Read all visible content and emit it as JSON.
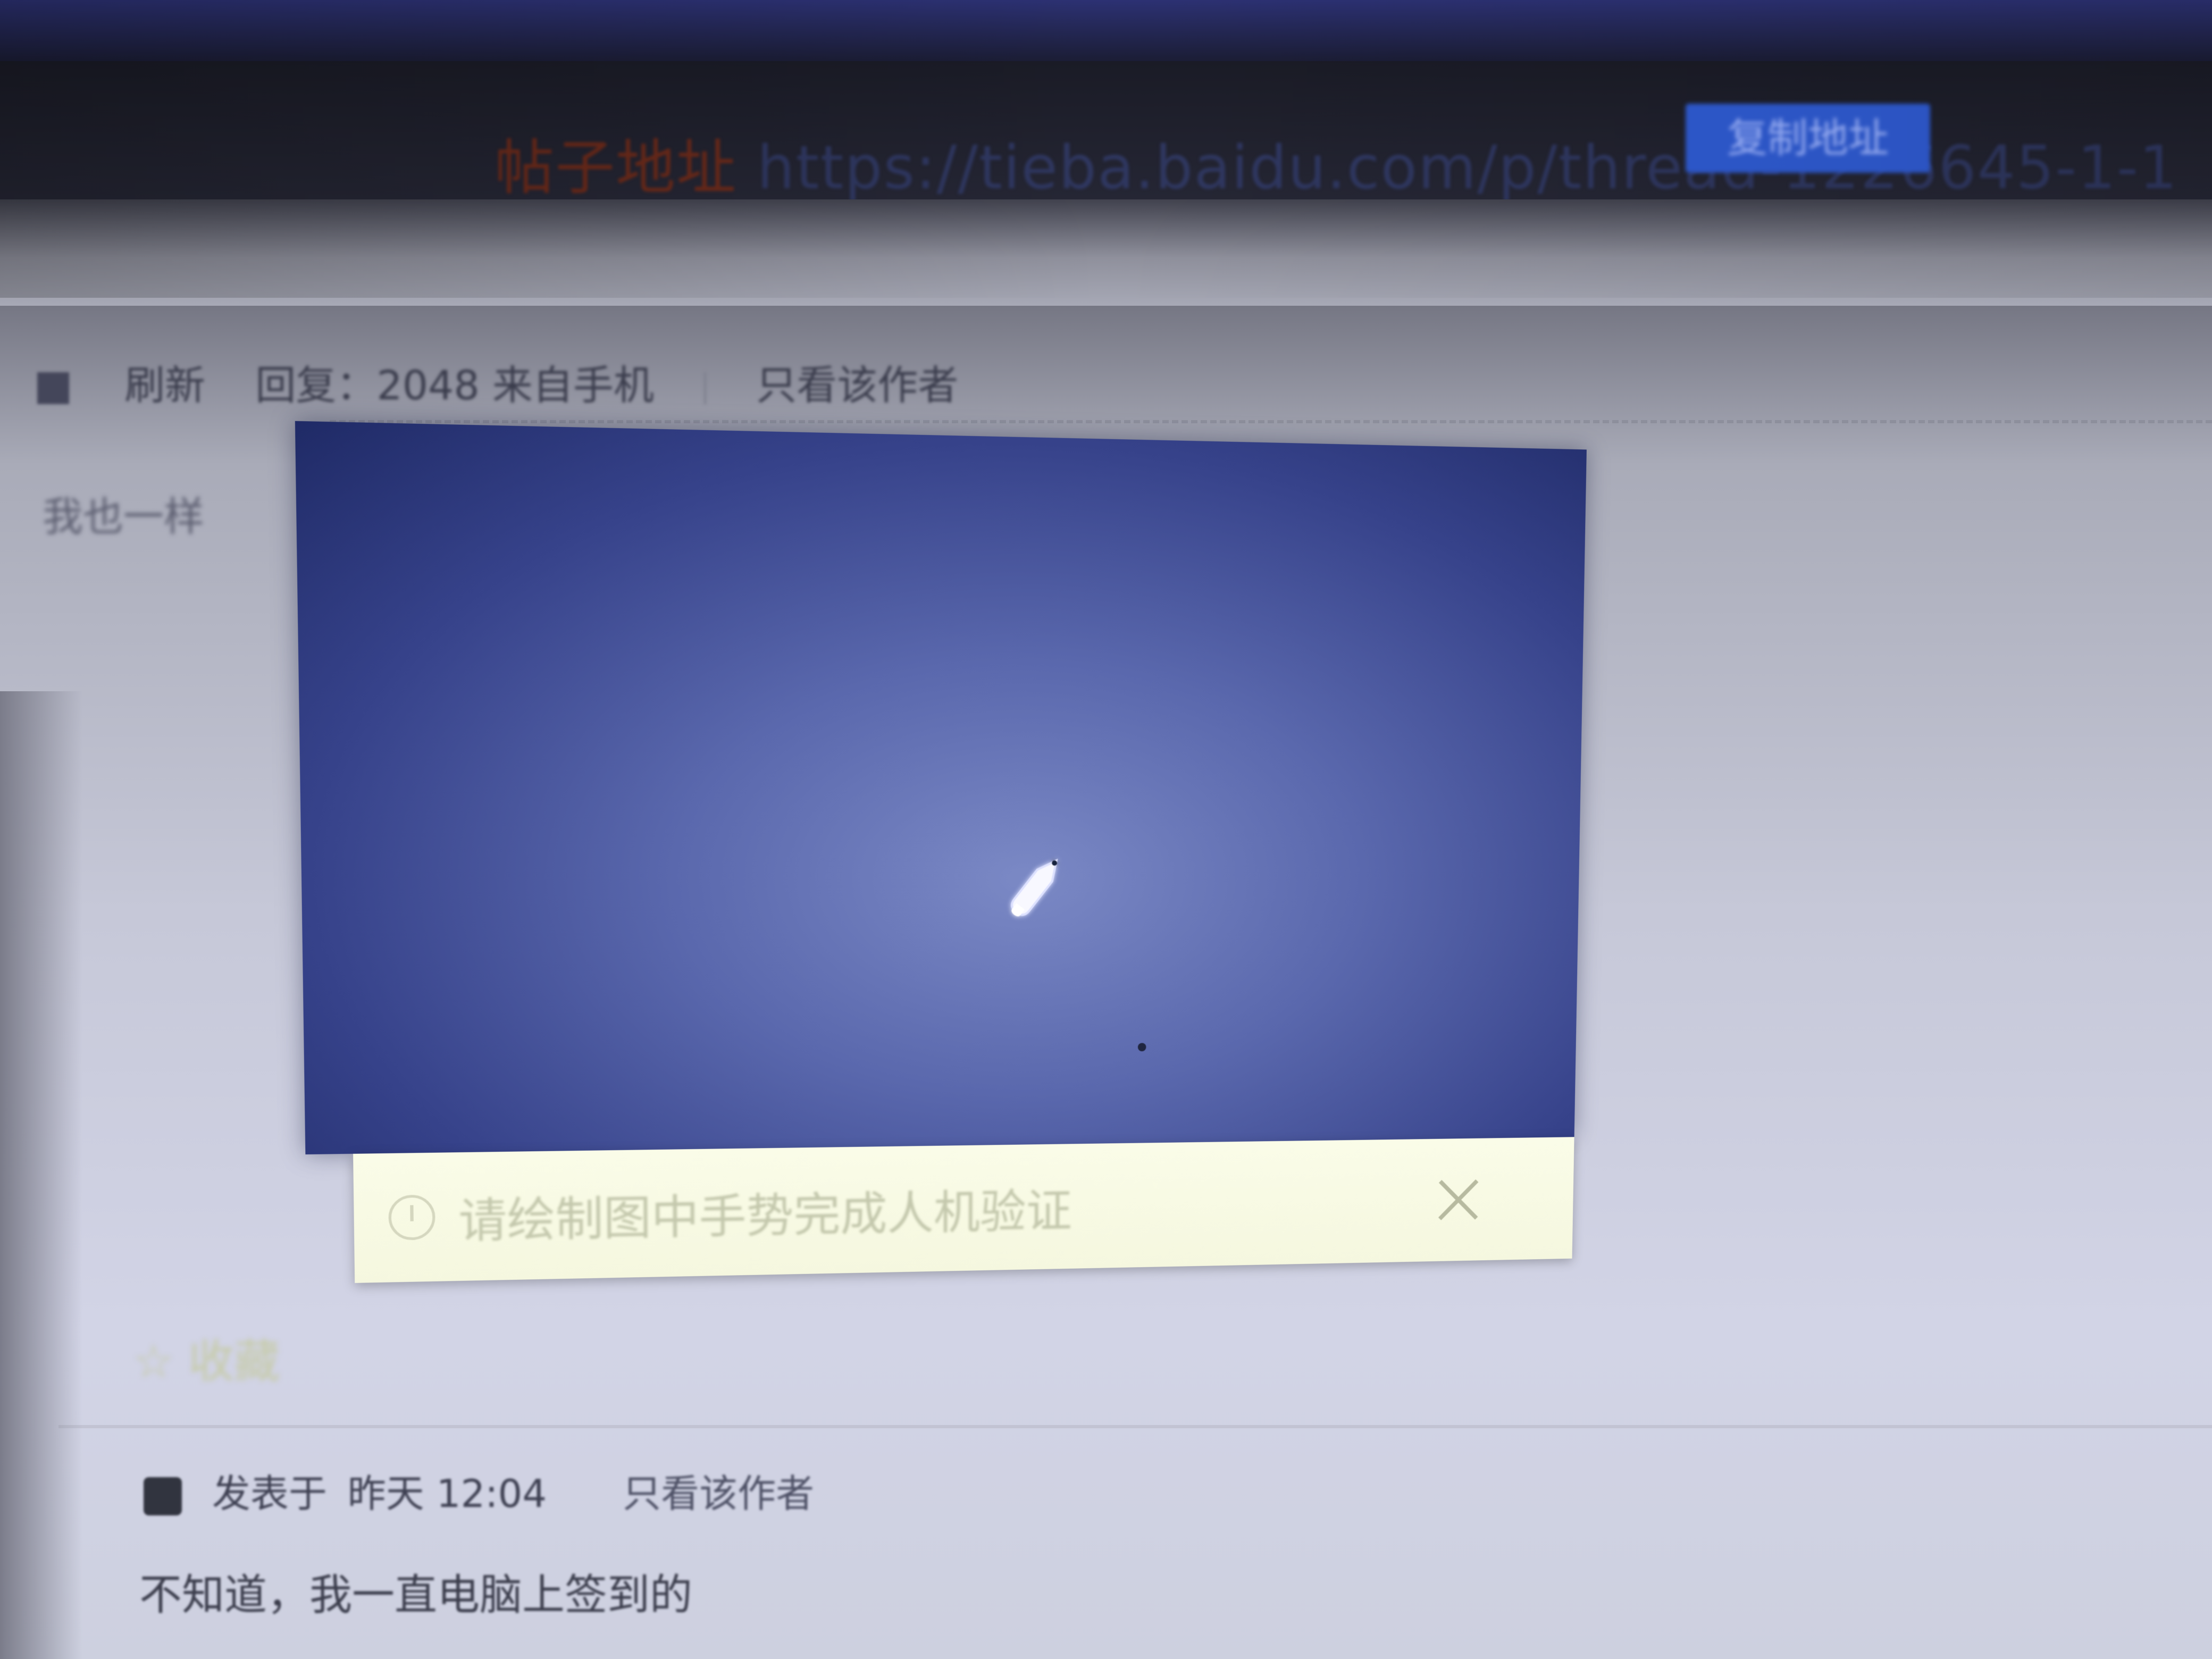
{
  "browser": {
    "url_prefix": "帖子地址",
    "url": "https://tieba.baidu.com/p/thread-1226645-1-1",
    "button_label": "复制地址"
  },
  "post_header": {
    "username": "刷新",
    "title": "回复：2048 来自手机",
    "only_author_label": "只看该作者"
  },
  "post_first_line": "我也一样",
  "captcha": {
    "instruction": "请绘制图中手势完成人机验证",
    "close_icon": "close-icon",
    "info_icon": "info-icon",
    "cursor_icon": "pencil-cursor"
  },
  "decorative": {
    "star_text": "☆ 收藏"
  },
  "comment": {
    "author": "发表于",
    "date": "昨天 12:04",
    "only_author_label": "只看该作者",
    "body": "不知道，我一直电脑上签到的"
  },
  "colors": {
    "captcha_dark": "#1f2a66",
    "captcha_light": "#7b89c5",
    "captcha_bar": "#fafce8",
    "url_button": "#2f5bd2"
  }
}
